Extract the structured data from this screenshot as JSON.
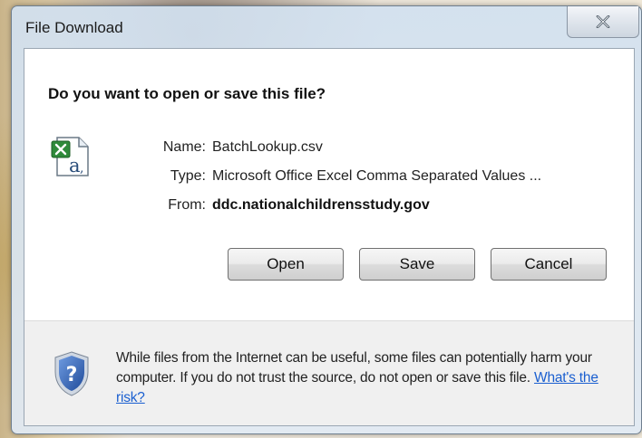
{
  "window": {
    "title": "File Download",
    "close_glyph": "✕"
  },
  "dialog": {
    "question": "Do you want to open or save this file?",
    "file_icon": "excel-csv-file-icon",
    "fields": {
      "name_label": "Name:",
      "name_value": "BatchLookup.csv",
      "type_label": "Type:",
      "type_value": "Microsoft Office Excel Comma Separated Values ...",
      "from_label": "From:",
      "from_value": "ddc.nationalchildrensstudy.gov"
    },
    "buttons": {
      "open": "Open",
      "save": "Save",
      "cancel": "Cancel"
    }
  },
  "footer": {
    "icon": "security-shield-question-icon",
    "warning_text": "While files from the Internet can be useful, some files can potentially harm your computer. If you do not trust the source, do not open or save this file.",
    "risk_link": "What's the risk?"
  },
  "colors": {
    "link": "#1a5fd0",
    "shield": "#2c5ba8"
  }
}
